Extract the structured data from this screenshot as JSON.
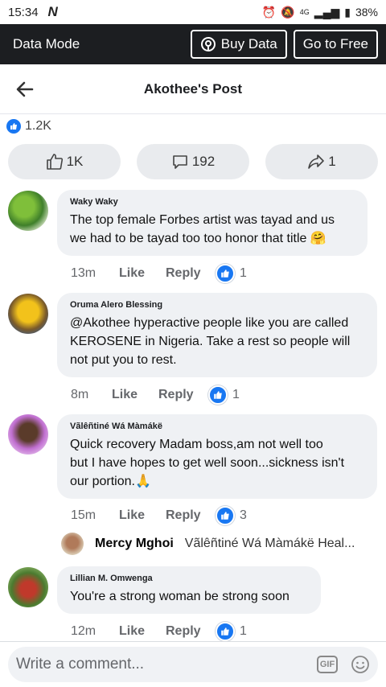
{
  "status_bar": {
    "time": "15:34",
    "carrier_logo": "N",
    "network": "4G",
    "battery": "38%"
  },
  "data_mode": {
    "label": "Data Mode",
    "buy_data": "Buy Data",
    "go_to_free": "Go to Free"
  },
  "header": {
    "title": "Akothee's Post"
  },
  "reaction_summary": {
    "count": "1.2K"
  },
  "actions": {
    "likes": "1K",
    "comments": "192",
    "shares": "1"
  },
  "comments": [
    {
      "author": "Waky Waky",
      "lines": [
        "The top female Forbes artist was tayad and us",
        "we had to be tayad too too honor that title 🤗"
      ],
      "time": "13m",
      "like": "Like",
      "reply": "Reply",
      "reactions": "1"
    },
    {
      "author": "Oruma Alero Blessing",
      "lines": [
        "@Akothee hyperactive people like you are called",
        "KEROSENE in Nigeria. Take a rest so people will",
        "not put you to rest."
      ],
      "time": "8m",
      "like": "Like",
      "reply": "Reply",
      "reactions": "1"
    },
    {
      "author": "Vãlêñtiné Wá Màmákë",
      "lines": [
        "Quick recovery Madam boss,am not well too",
        "but I have hopes to get well soon...sickness isn't",
        "our portion.🙏"
      ],
      "time": "15m",
      "like": "Like",
      "reply": "Reply",
      "reactions": "3"
    },
    {
      "author": "Lillian M. Omwenga",
      "lines": [
        "You're a strong woman be strong soon"
      ],
      "time": "12m",
      "like": "Like",
      "reply": "Reply",
      "reactions": "1"
    }
  ],
  "reply_preview": {
    "name": "Mercy Mghoi",
    "text": "Vãlêñtiné Wá Màmákë Heal..."
  },
  "composer": {
    "placeholder": "Write a comment...",
    "gif_label": "GIF"
  },
  "colors": {
    "accent": "#1877f2",
    "dark_bar": "#1c1e21",
    "bubble": "#eff1f4"
  }
}
